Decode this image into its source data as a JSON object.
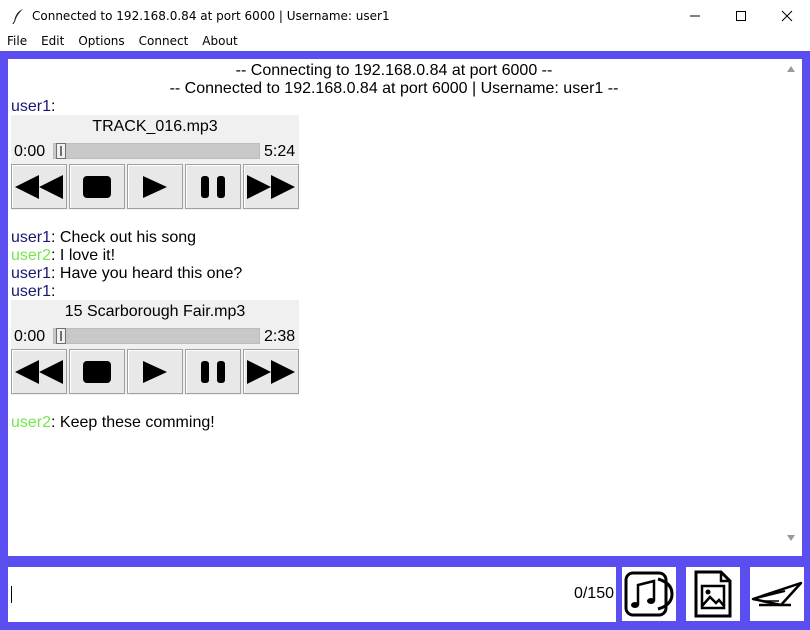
{
  "window": {
    "title": "Connected to 192.168.0.84 at port 6000 | Username: user1"
  },
  "menu": [
    "File",
    "Edit",
    "Options",
    "Connect",
    "About"
  ],
  "status": {
    "connecting": "-- Connecting to 192.168.0.84 at port 6000 --",
    "connected": "-- Connected to 192.168.0.84 at port 6000 | Username: user1 --"
  },
  "messages": [
    {
      "user": "user1",
      "sep": ":",
      "text": ""
    },
    {
      "user": "user1",
      "sep": ":",
      "text": " Check out his song"
    },
    {
      "user": "user2",
      "sep": ":",
      "text": " I love it!"
    },
    {
      "user": "user1",
      "sep": ":",
      "text": " Have you heard this one?"
    },
    {
      "user": "user1",
      "sep": ":",
      "text": ""
    },
    {
      "user": "user2",
      "sep": ":",
      "text": " Keep these comming!"
    }
  ],
  "players": [
    {
      "file": "TRACK_016.mp3",
      "current": "0:00",
      "duration": "5:24",
      "progress": 0
    },
    {
      "file": "15 Scarborough Fair.mp3",
      "current": "0:00",
      "duration": "2:38",
      "progress": 0
    }
  ],
  "input": {
    "value": "",
    "counter": "0/150"
  },
  "icons": {
    "rewind": "rewind-icon",
    "stop": "stop-icon",
    "play": "play-icon",
    "pause": "pause-icon",
    "fast_forward": "fast-forward-icon",
    "send_music": "music-file-icon",
    "send_image": "image-file-icon",
    "send": "send-icon"
  },
  "colors": {
    "frame": "#5b4ef0",
    "user1": "#1a1773",
    "user2": "#74e84a"
  }
}
